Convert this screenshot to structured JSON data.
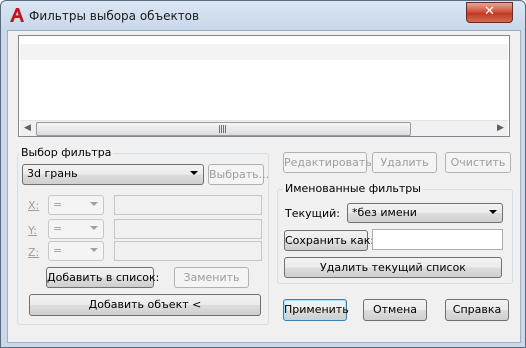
{
  "window": {
    "title": "Фильтры выбора объектов",
    "close_glyph": "✕",
    "icon": "autocad-a-icon"
  },
  "list": {
    "rows": []
  },
  "filter_selection": {
    "group_label": "Выбор фильтра",
    "object_type": "3d грань",
    "select_button": "Выбрать...",
    "axes": [
      {
        "label": "X:",
        "operator": "=",
        "value": ""
      },
      {
        "label": "Y:",
        "operator": "=",
        "value": ""
      },
      {
        "label": "Z:",
        "operator": "=",
        "value": ""
      }
    ],
    "add_to_list_button": "Добавить в список:",
    "replace_button": "Заменить",
    "add_object_button": "Добавить объект <"
  },
  "list_actions": {
    "edit_button": "Редактировать",
    "delete_button": "Удалить",
    "clear_button": "Очистить"
  },
  "named_filters": {
    "group_label": "Именованные фильтры",
    "current_label": "Текущий:",
    "current_value": "*без имени",
    "save_as_button": "Сохранить как:",
    "save_as_value": "",
    "delete_current_button": "Удалить текущий список"
  },
  "footer": {
    "apply_button": "Применить",
    "cancel_button": "Отмена",
    "help_button": "Справка"
  }
}
